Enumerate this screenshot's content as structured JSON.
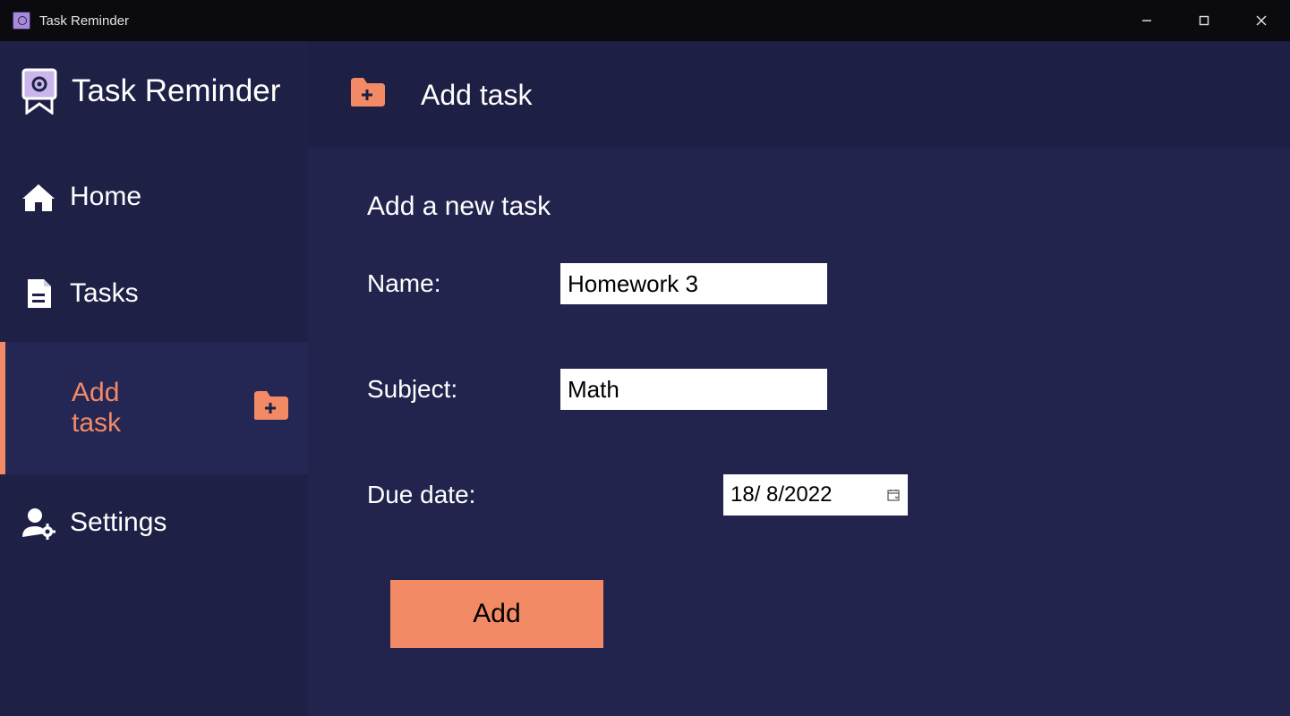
{
  "window": {
    "title": "Task Reminder"
  },
  "sidebar": {
    "brand": "Task Reminder",
    "items": {
      "home": "Home",
      "tasks": "Tasks",
      "add_task": "Add task",
      "settings": "Settings"
    }
  },
  "header": {
    "title": "Add task"
  },
  "form": {
    "heading": "Add a new task",
    "labels": {
      "name": "Name:",
      "subject": "Subject:",
      "due_date": "Due date:"
    },
    "values": {
      "name": "Homework 3",
      "subject": "Math",
      "due_date": "18/  8/2022"
    },
    "submit_label": "Add"
  },
  "colors": {
    "accent": "#f38a66",
    "bg_sidebar": "#1f2046",
    "bg_content": "#22244d",
    "bg_header": "#1e1f44"
  }
}
